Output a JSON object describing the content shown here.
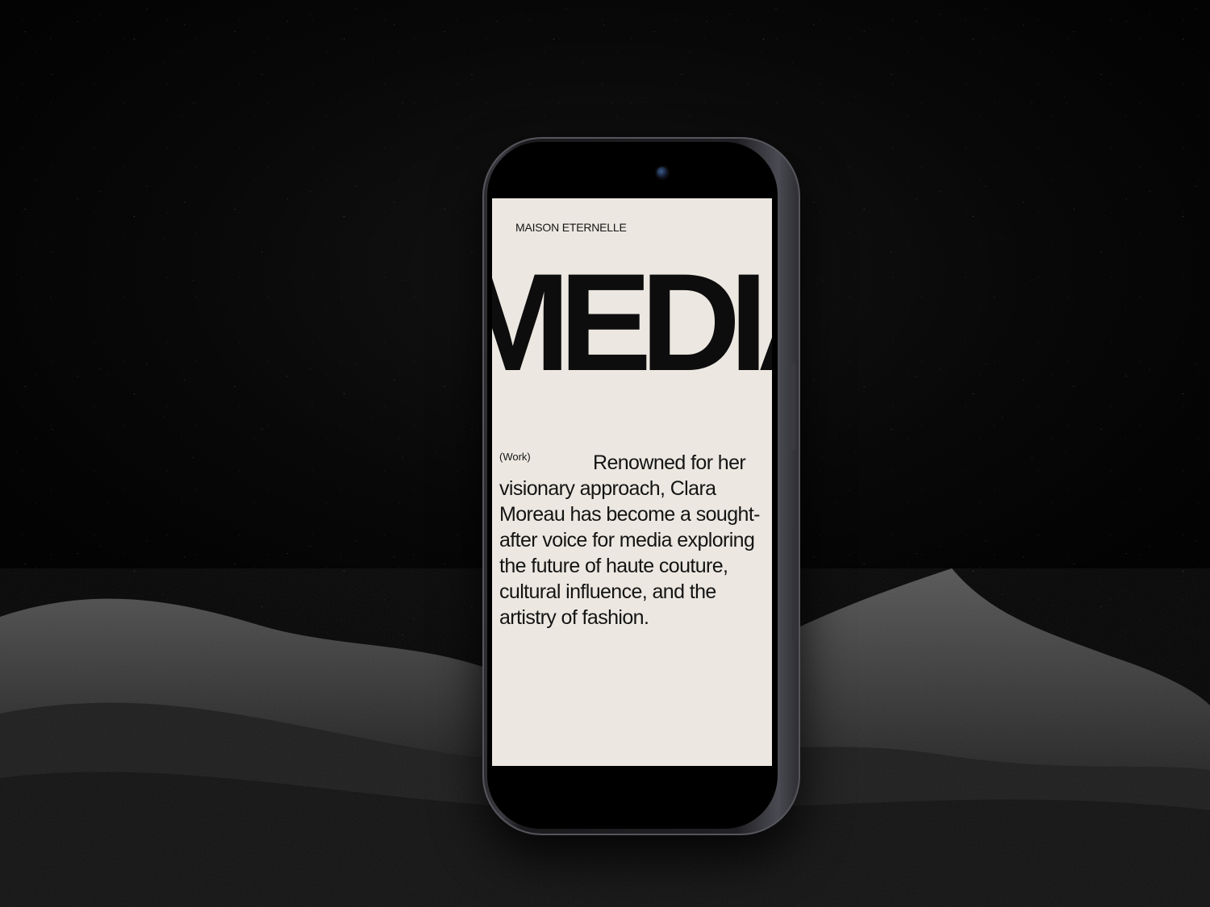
{
  "site": {
    "brand": "MAISON ETERNELLE",
    "hero_word": "MEDIA/"
  },
  "section": {
    "label": "(Work)",
    "body": "Renowned for her visionary approach, Clara Moreau has become a sought-after voice for media exploring the future of haute couture, cultural influence, and the artistry of fashion."
  },
  "colors": {
    "screen_background": "#ece8e1",
    "text": "#141414",
    "scene_background": "#050505"
  }
}
